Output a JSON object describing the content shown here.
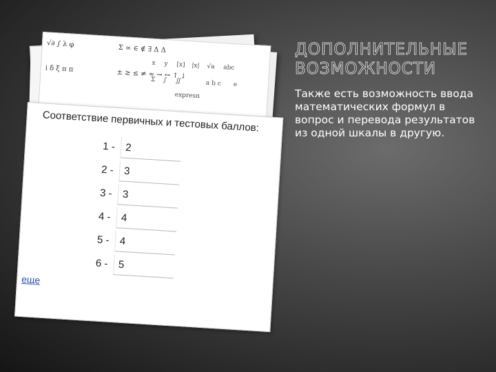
{
  "slide": {
    "title": "ДОПОЛНИТЕЛЬНЫЕ ВОЗМОЖНОСТИ",
    "body": "Также есть возможность ввода математических формул в вопрос и перевода результатов из одной шкалы в другую."
  },
  "formula_toolbar": {
    "row1": "√∂ ∫ λ φ",
    "row2": "i δ ξ π π",
    "row3": "Σ ∞ ∈ ∉ ∃ Δ Δ",
    "row4": "± ≥ ≤ ≠ ≈ → ↔ ↑ ↓",
    "matrix": [
      "x",
      "y",
      "[x]",
      "|x|",
      "√a",
      "abc",
      "Σ",
      "∫",
      "∬",
      "a b c",
      "e",
      "expresn"
    ]
  },
  "score_card": {
    "title": "Соответствие первичных и тестовых баллов:",
    "rows": [
      {
        "label": "1 -",
        "value": "2"
      },
      {
        "label": "2 -",
        "value": "3"
      },
      {
        "label": "3 -",
        "value": "3"
      },
      {
        "label": "4 -",
        "value": "4"
      },
      {
        "label": "5 -",
        "value": "4"
      },
      {
        "label": "6 -",
        "value": "5"
      }
    ],
    "more_link": "еще"
  }
}
